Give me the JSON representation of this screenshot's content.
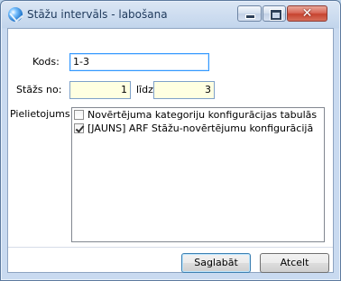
{
  "window": {
    "title": "Stāžu intervāls - labošana",
    "close_glyph": "✕"
  },
  "form": {
    "kods_label": "Kods:",
    "kods_value": "1-3",
    "stazs_label": "Stāžs no:",
    "stazs_from": "1",
    "lidz_label": "līdz",
    "stazs_to": "3",
    "pielietojums_label": "Pielietojums:"
  },
  "list": {
    "items": [
      {
        "label": "Novērtējuma kategoriju konfigurācijas tabulās",
        "checked": false
      },
      {
        "label": "[JAUNS] ARF Stāžu-novērtējumu konfigurācijā",
        "checked": true
      }
    ]
  },
  "buttons": {
    "save": "Saglabāt",
    "cancel": "Atcelt"
  }
}
